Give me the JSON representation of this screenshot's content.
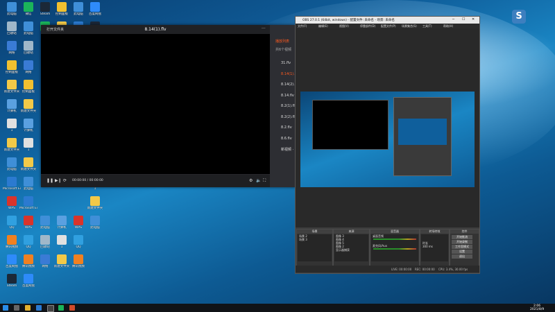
{
  "player": {
    "open_label": "打开文件夹",
    "title": "8.14(1).flv",
    "more": "···",
    "time": "00:00:00 / 00:00:00",
    "playlist_header": "播放列表",
    "playlist_sub": "共6个视频",
    "playlist": [
      "31.flv",
      "8.14(1).flv",
      "8.14(2).flv",
      "8.14.flv",
      "8.2(1).flv",
      "8.2(2).flv",
      "8.2.flv",
      "8.6.flv",
      "新视频 · 先前的"
    ],
    "active_index": 1,
    "accent": "#ff5a1f"
  },
  "obs": {
    "title": "OBS 27.0.1 (64bit, windows) - 配置文件: 未命名 - 场景: 未命名",
    "menu": [
      "文件(F)",
      "编辑(E)",
      "视图(V)",
      "停靠部件(D)",
      "配置文件(P)",
      "场景集合(S)",
      "工具(T)",
      "帮助(H)"
    ],
    "panels": {
      "scenes": {
        "title": "场景",
        "items": [
          "场景 2",
          "场景 3"
        ]
      },
      "sources": {
        "title": "来源",
        "items": [
          "图像 3",
          "图像 4",
          "图像 5",
          "图像 2",
          "显示器捕获"
        ]
      },
      "mixer": {
        "title": "混音器",
        "items": [
          "桌面音频",
          "麦克风/Aux"
        ]
      },
      "transitions": {
        "title": "转场特效",
        "duration_label": "时长",
        "duration": "300 ms"
      },
      "controls": {
        "title": "控件",
        "buttons": [
          "开始推流",
          "开始录制",
          "工作室模式",
          "设置",
          "退出"
        ]
      }
    },
    "status": {
      "live": "LIVE: 00:00:00",
      "rec": "REC: 00:00:00",
      "cpu": "CPU: 3.4%, 30.00 fps"
    }
  },
  "desktop_icons": [
    "此电脑",
    "回收站",
    "网络",
    "控制面板",
    "新建文件夹",
    "计算机",
    "1",
    "新建文件夹",
    "此电脑",
    "Microsoft Edge",
    "WPS",
    "QQ",
    "腾讯视频",
    "百度网盘",
    "Steam",
    "微信"
  ],
  "taskbar": {
    "time": "2:06",
    "date": "2021/8/9"
  },
  "logo_letter": "S"
}
